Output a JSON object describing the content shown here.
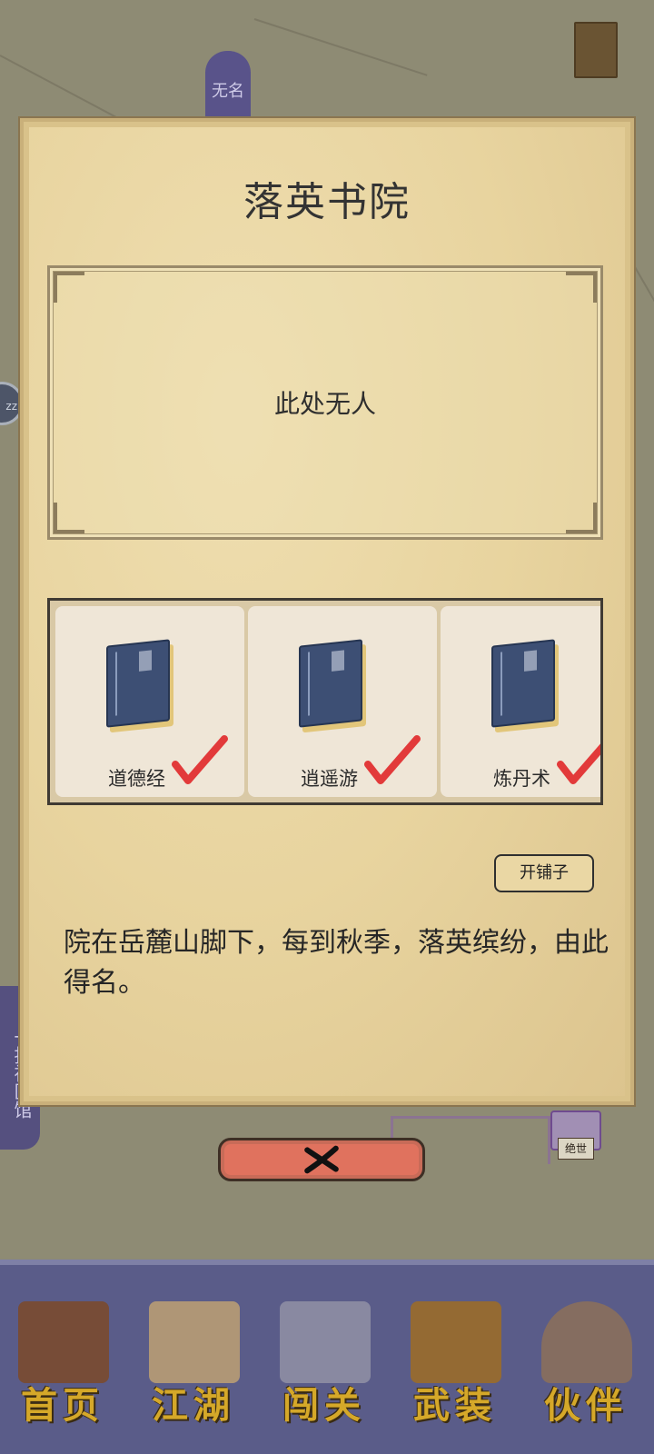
{
  "background": {
    "map_tag_top": "无名",
    "map_tag_lower": "一指神医馆",
    "map_shop_label": "绝世",
    "map_circle_label": "zz"
  },
  "dialog": {
    "title": "落英书院",
    "empty_text": "此处无人",
    "items": [
      {
        "name": "道德经",
        "checked": true
      },
      {
        "name": "逍遥游",
        "checked": true
      },
      {
        "name": "炼丹术",
        "checked": true
      }
    ],
    "open_shop_label": "开铺子",
    "description": "院在岳麓山脚下，每到秋季，落英缤纷，由此得名。",
    "close_icon": "close-x-icon"
  },
  "bottom_nav": [
    {
      "label": "首页",
      "icon": "temple-icon"
    },
    {
      "label": "江湖",
      "icon": "scroll-map-icon"
    },
    {
      "label": "闯关",
      "icon": "crossed-swords-icon"
    },
    {
      "label": "武装",
      "icon": "armor-icon"
    },
    {
      "label": "伙伴",
      "icon": "partners-icon"
    }
  ],
  "colors": {
    "dialog_bg": "#e8d49f",
    "close_button": "#e0725e",
    "check": "#e23a3a",
    "nav_bg": "#5a5c89",
    "nav_label": "#d5a829"
  }
}
